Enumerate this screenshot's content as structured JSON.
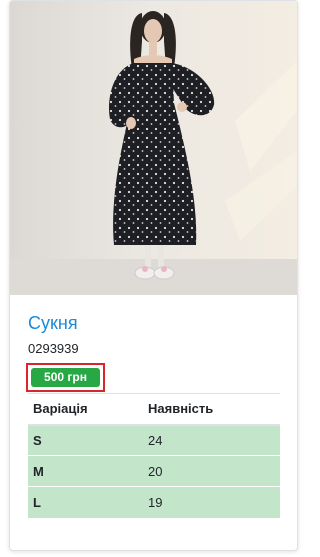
{
  "product": {
    "title": "Сукня",
    "sku": "0293939",
    "price": "500 грн"
  },
  "table": {
    "headers": [
      "Варіація",
      "Наявність"
    ],
    "rows": [
      {
        "size": "S",
        "stock": "24"
      },
      {
        "size": "M",
        "stock": "20"
      },
      {
        "size": "L",
        "stock": "19"
      }
    ]
  },
  "colors": {
    "title_link": "#1b8ad8",
    "price_badge": "#28a745",
    "price_frame": "#d9262c",
    "row_success": "#c3e6cb"
  }
}
